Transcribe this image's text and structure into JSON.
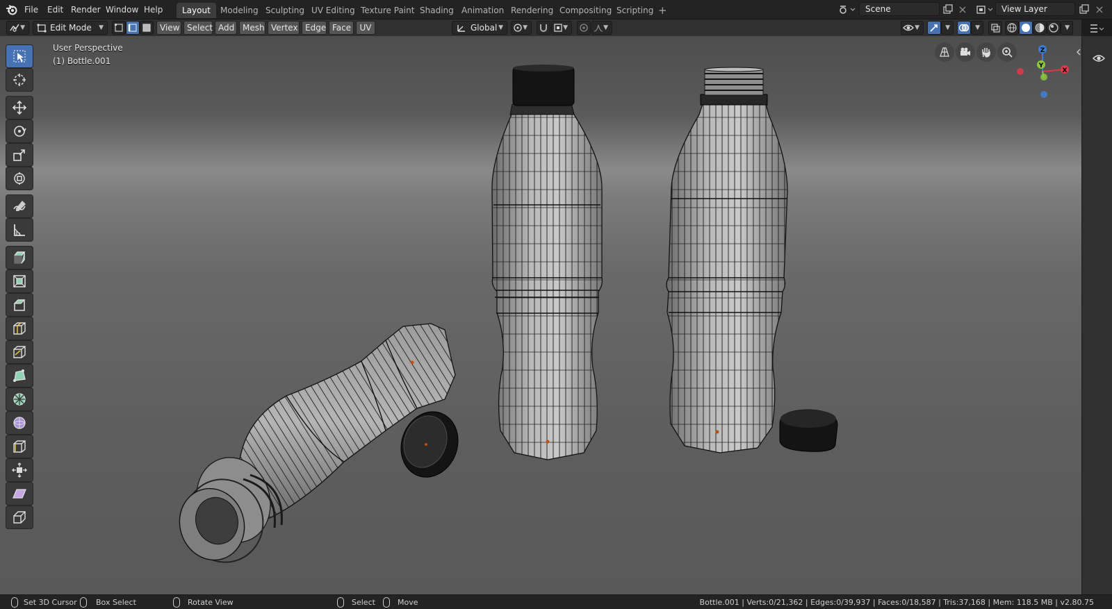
{
  "topbar": {
    "menus": [
      "File",
      "Edit",
      "Render",
      "Window",
      "Help"
    ],
    "workspace_tabs": [
      "Layout",
      "Modeling",
      "Sculpting",
      "UV Editing",
      "Texture Paint",
      "Shading",
      "Animation",
      "Rendering",
      "Compositing",
      "Scripting"
    ],
    "active_tab": "Layout",
    "add_workspace": "+",
    "scene_name": "Scene",
    "view_layer_name": "View Layer"
  },
  "header": {
    "mode": "Edit Mode",
    "menus": [
      "View",
      "Select",
      "Add",
      "Mesh",
      "Vertex",
      "Edge",
      "Face",
      "UV"
    ],
    "transform_orientation": "Global"
  },
  "viewport": {
    "view_name": "User Perspective",
    "object_label": "(1) Bottle.001",
    "gizmo_axes": [
      "X",
      "Y",
      "Z"
    ]
  },
  "statusbar": {
    "left_click_label": "Set 3D Cursor",
    "drag_label": "Box Select",
    "middle_label": "Rotate View",
    "select_label": "Select",
    "move_label": "Move",
    "stats": "Bottle.001 | Verts:0/21,362 | Edges:0/39,937 | Faces:0/18,587 | Tris:37,168 | Mem: 118.5 MB | v2.80.75"
  },
  "colors": {
    "accent": "#4772b3",
    "axis_x": "#e0394a",
    "axis_y": "#8cc83c",
    "axis_z": "#3d7fd6"
  }
}
